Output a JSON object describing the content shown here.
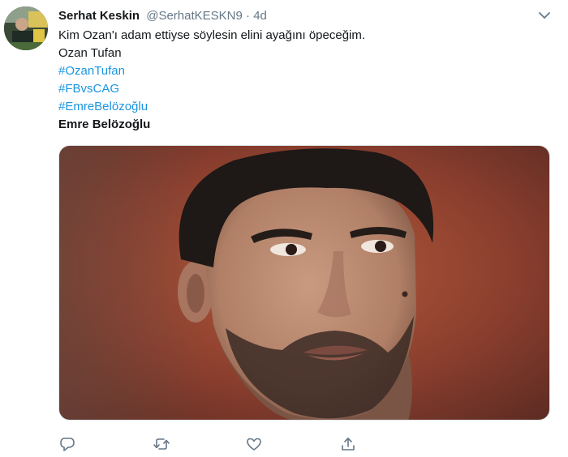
{
  "tweet": {
    "display_name": "Serhat Keskin",
    "handle": "@SerhatKESKN9",
    "separator": "·",
    "time": "4d",
    "lines": [
      "Kim Ozan'ı adam ettiyse söylesin elini ayağını öpeceğim.",
      "Ozan Tufan"
    ],
    "hashtags": [
      "#OzanTufan",
      "#FBvsCAG",
      "#EmreBelözoğlu"
    ],
    "bold_line": "Emre Belözoğlu"
  },
  "colors": {
    "link": "#1b95e0",
    "text": "#14171a",
    "muted": "#657786",
    "border": "#e1e8ed"
  },
  "icons": {
    "caret": "chevron-down-icon",
    "reply": "reply-icon",
    "retweet": "retweet-icon",
    "like": "heart-icon",
    "share": "share-icon"
  }
}
